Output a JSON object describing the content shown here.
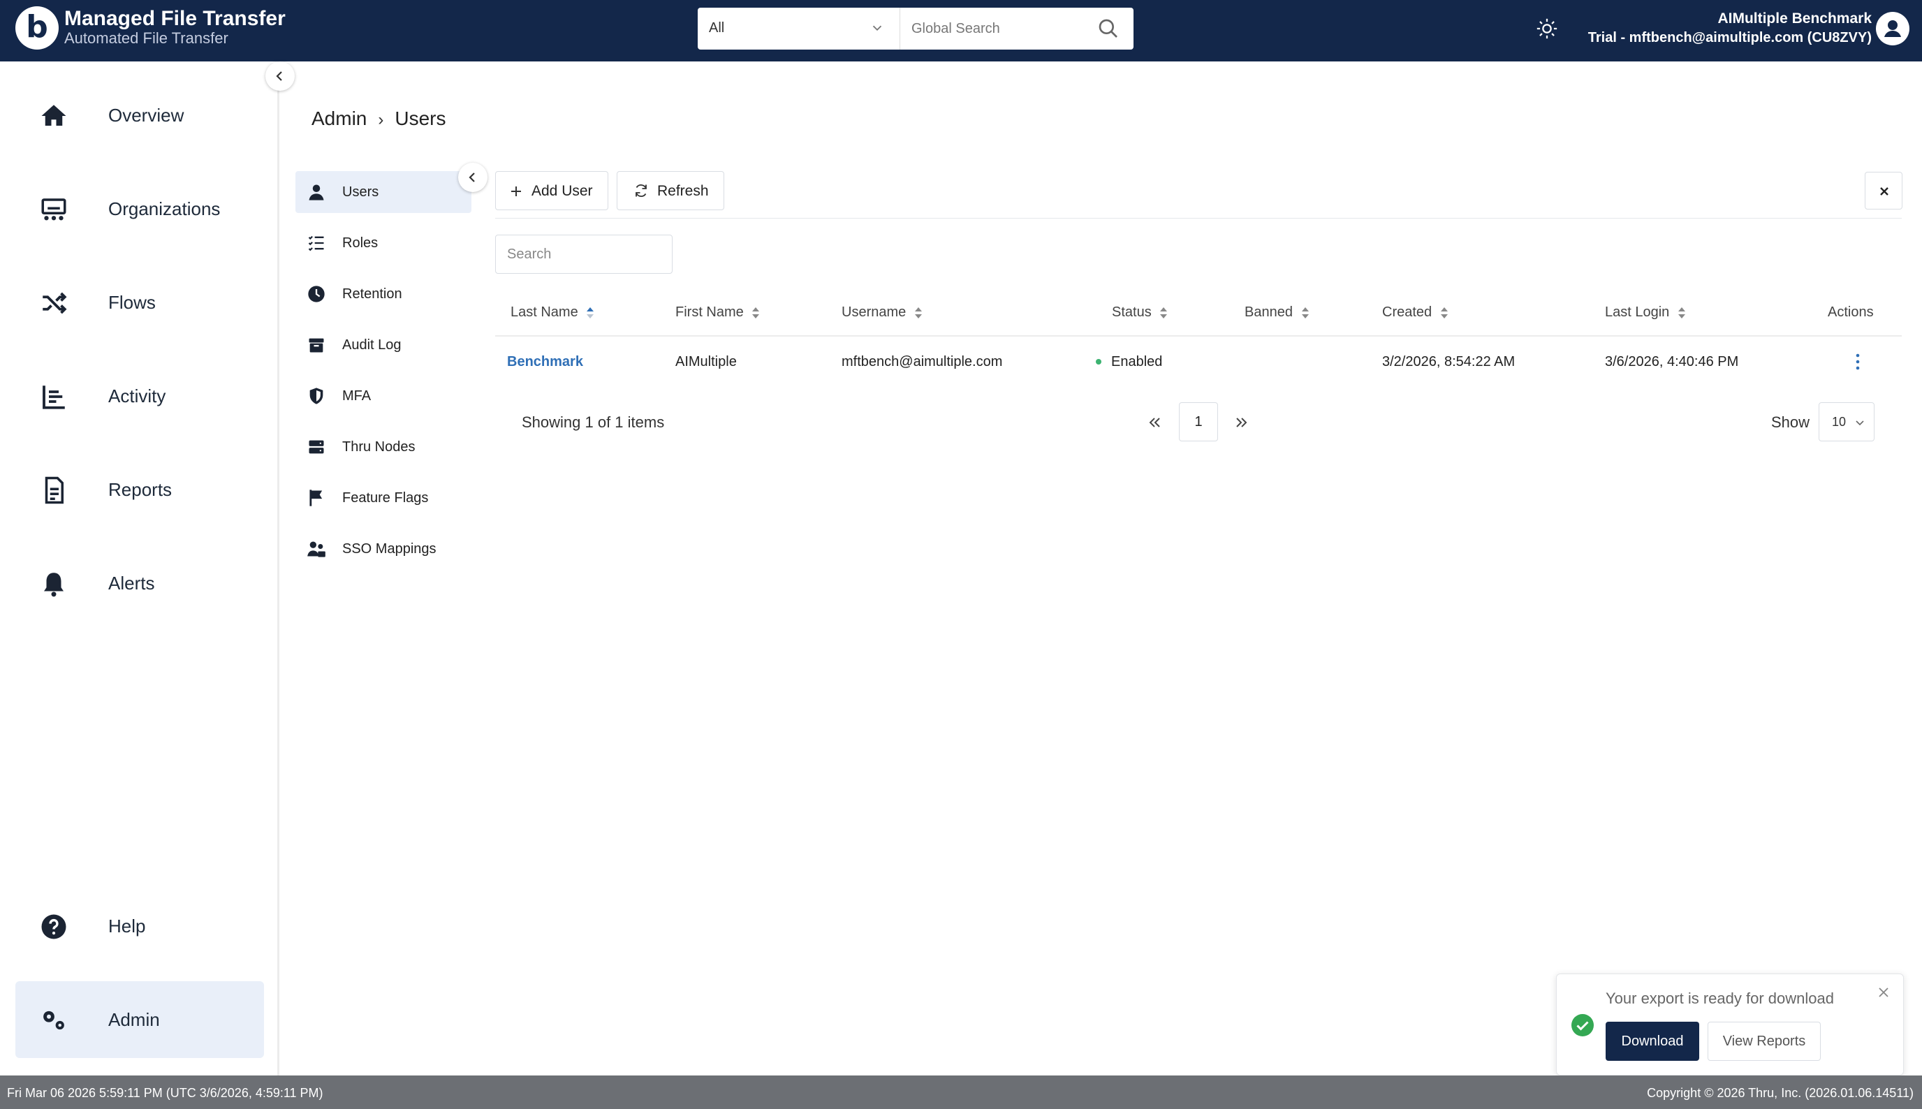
{
  "app": {
    "logo_letter": "b",
    "title": "Managed File Transfer",
    "subtitle": "Automated File Transfer"
  },
  "search": {
    "scope": "All",
    "placeholder": "Global Search"
  },
  "user": {
    "name": "AIMultiple Benchmark",
    "account": "Trial - mftbench@aimultiple.com (CU8ZVY)"
  },
  "sidebar": {
    "items": [
      {
        "label": "Overview",
        "icon": "home-icon"
      },
      {
        "label": "Organizations",
        "icon": "organization-icon"
      },
      {
        "label": "Flows",
        "icon": "shuffle-icon"
      },
      {
        "label": "Activity",
        "icon": "chart-icon"
      },
      {
        "label": "Reports",
        "icon": "document-icon"
      },
      {
        "label": "Alerts",
        "icon": "bell-icon"
      },
      {
        "label": "Help",
        "icon": "help-icon"
      },
      {
        "label": "Admin",
        "icon": "gears-icon",
        "active": true
      }
    ]
  },
  "breadcrumb": {
    "parent": "Admin",
    "separator": "›",
    "current": "Users"
  },
  "subnav": {
    "items": [
      {
        "label": "Users",
        "icon": "user-icon",
        "active": true
      },
      {
        "label": "Roles",
        "icon": "list-check-icon"
      },
      {
        "label": "Retention",
        "icon": "clock-icon"
      },
      {
        "label": "Audit Log",
        "icon": "box-icon"
      },
      {
        "label": "MFA",
        "icon": "shield-icon"
      },
      {
        "label": "Thru Nodes",
        "icon": "server-icon"
      },
      {
        "label": "Feature Flags",
        "icon": "flag-icon"
      },
      {
        "label": "SSO Mappings",
        "icon": "users-icon"
      }
    ]
  },
  "toolbar": {
    "add_user": "Add User",
    "refresh": "Refresh",
    "close_symbol": "✕"
  },
  "table": {
    "search_placeholder": "Search",
    "columns": [
      "Last Name",
      "First Name",
      "Username",
      "Status",
      "Banned",
      "Created",
      "Last Login",
      "Actions"
    ],
    "sorted_column": "Last Name",
    "rows": [
      {
        "last_name": "Benchmark",
        "first_name": "AIMultiple",
        "username": "mftbench@aimultiple.com",
        "status": "Enabled",
        "banned": "",
        "created": "3/2/2026, 8:54:22 AM",
        "last_login": "3/6/2026, 4:40:46 PM"
      }
    ],
    "status_color": "#3cb371"
  },
  "pagination": {
    "showing": "Showing 1 of 1 items",
    "current_page": "1",
    "show_label": "Show",
    "page_size": "10"
  },
  "toast": {
    "message": "Your export is ready for download",
    "primary": "Download",
    "secondary": "View Reports"
  },
  "footer": {
    "left": "Fri Mar 06 2026 5:59:11 PM (UTC 3/6/2026, 4:59:11 PM)",
    "right": "Copyright © 2026 Thru, Inc. (2026.01.06.14511)"
  },
  "colors": {
    "navy": "#13274a",
    "link": "#2f6fb6",
    "active_bg": "#e9eff9",
    "footer": "#6c6f74"
  }
}
